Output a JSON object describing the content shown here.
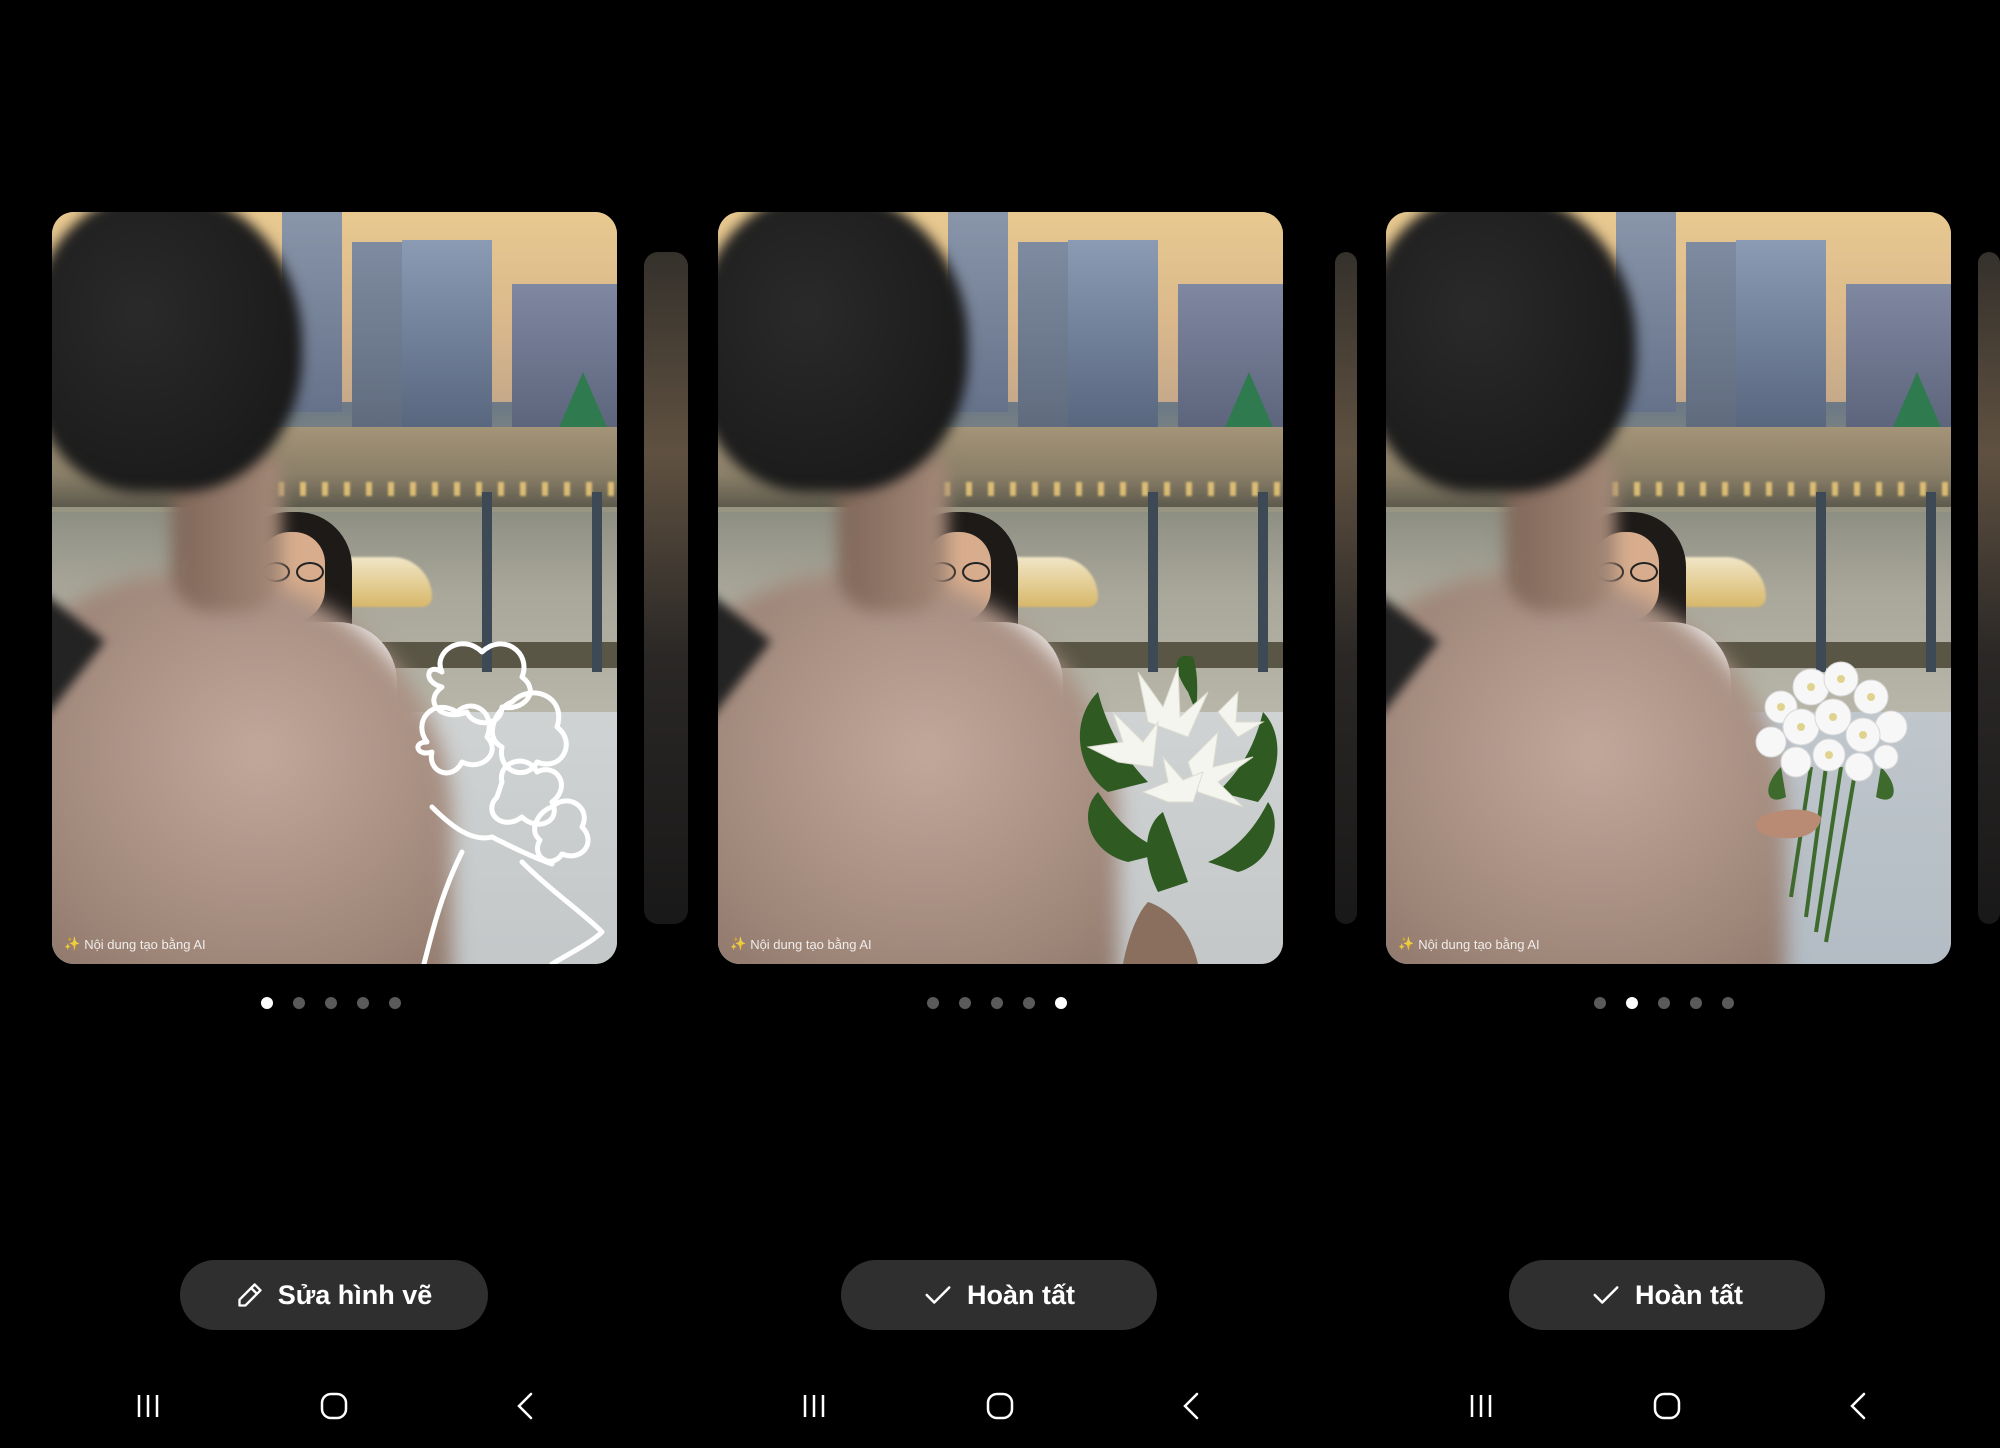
{
  "panels": [
    {
      "ai_label": "Nội dung tạo bằng AI",
      "dots": {
        "count": 5,
        "active_index": 0
      },
      "action": {
        "label": "Sửa hình vẽ",
        "icon": "pencil-icon"
      },
      "overlay": "sketch"
    },
    {
      "ai_label": "Nội dung tạo bằng AI",
      "dots": {
        "count": 5,
        "active_index": 4
      },
      "action": {
        "label": "Hoàn tất",
        "icon": "check-icon"
      },
      "overlay": "lily-bouquet"
    },
    {
      "ai_label": "Nội dung tạo bằng AI",
      "dots": {
        "count": 5,
        "active_index": 1
      },
      "action": {
        "label": "Hoàn tất",
        "icon": "check-icon"
      },
      "overlay": "chrysanthemum-bouquet"
    }
  ],
  "navbar": {
    "recent_icon": "recent-apps-icon",
    "home_icon": "home-icon",
    "back_icon": "back-icon"
  },
  "colors": {
    "background": "#000000",
    "button_bg": "#2f2f2f",
    "dot_active": "#ffffff",
    "dot_inactive": "#5a5a5a"
  }
}
